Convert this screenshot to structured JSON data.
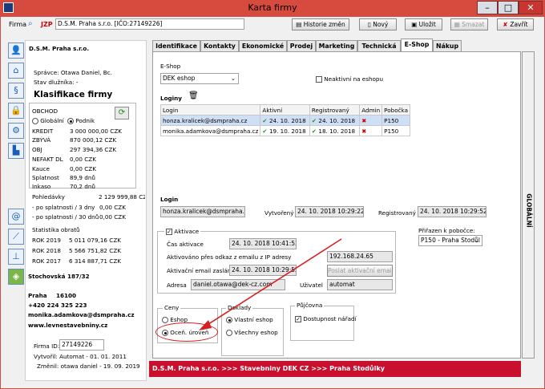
{
  "window": {
    "title": "Karta firmy",
    "minimize": "–",
    "maximize": "□",
    "close": "✕"
  },
  "toolbar": {
    "firma_label": "Firma",
    "jzp_label": "JZP",
    "firma_value": "D.S.M. Praha s.r.o.  [IČO:27149226]",
    "historie_label": "Historie změn",
    "novy_label": "Nový",
    "ulozit_label": "Uložit",
    "smazat_label": "Smazat",
    "zavrit_label": "Zavřít"
  },
  "left": {
    "company": "D.S.M. Praha s.r.o.",
    "spravce": "Správce:  Otawa Daniel, Bc.",
    "stav": "Stav dlužníka:  -",
    "klasifikace": "Klasifikace firmy",
    "obchod": "OBCHOD",
    "globalni": "Globální",
    "podnik": "Podnik",
    "rows": [
      {
        "k": "KREDIT",
        "v": "3 000 000,00 CZK"
      },
      {
        "k": "ZBÝVÁ",
        "v": "870 000,12 CZK"
      },
      {
        "k": "OBJ",
        "v": "297 394,36 CZK"
      },
      {
        "k": "NEFAKT DL",
        "v": "0,00 CZK"
      },
      {
        "k": "Kauce",
        "v": "0,00 CZK"
      },
      {
        "k": "Splatnost",
        "v": "89,9 dnů"
      },
      {
        "k": "Inkaso",
        "v": "70,2 dnů"
      }
    ],
    "pohledavky": "Pohledávky",
    "pohledavky_v": "2 129 999,88 CZ",
    "po1": "- po splatnosti / 3 dny",
    "po1_v": "0,00 CZK",
    "po2": "- po splatnosti / 30 dnů",
    "po2_v": "0,00 CZK",
    "statistika": "Statistika obratů",
    "roky": [
      {
        "k": "ROK 2019",
        "v": "5 011 079,16 CZK"
      },
      {
        "k": "ROK 2018",
        "v": "5 566 751,82 CZK"
      },
      {
        "k": "ROK 2017",
        "v": "6 314 887,71 CZK"
      }
    ],
    "address": "Stochovská 187/32",
    "city": "Praha",
    "zip": "16100",
    "phone": "+420 224 325 223",
    "email": "monika.adamkova@dsmpraha.cz",
    "web": "www.levnestavebniny.cz",
    "firma_id_label": "Firma ID:",
    "firma_id": "27149226",
    "vytvoril": "Vytvořil:  Automat - 01. 01. 2011",
    "zmenil": "Změnil:  otawa daniel - 19. 09. 2019"
  },
  "tabs": [
    "Identifikace",
    "Kontakty",
    "Ekonomické",
    "Prodej",
    "Marketing",
    "Technická",
    "E-Shop",
    "Nákup"
  ],
  "eshop": {
    "label": "E-Shop",
    "select": "DEK eshop",
    "neaktivni": "Neaktivní na eshopu",
    "loginy": "Loginy",
    "headers": [
      "Login",
      "Aktivní",
      "Registrovaný",
      "Admin",
      "Pobočka"
    ],
    "logins": [
      {
        "login": "honza.kralicek@dsmpraha.cz",
        "aktivni": "24. 10. 2018",
        "reg": "24. 10. 2018",
        "pobocka": "P150"
      },
      {
        "login": "monika.adamkova@dsmpraha.cz",
        "aktivni": "19. 10. 2018",
        "reg": "18. 10. 2018",
        "pobocka": "P150"
      }
    ],
    "login_label": "Login",
    "login_value": "honza.kralicek@dsmpraha.cz",
    "vytvoreny_label": "Vytvořený",
    "vytvoreny": "24. 10. 2018 10:29:22",
    "registrovany_label": "Registrovaný",
    "registrovany": "24. 10. 2018 10:29:52",
    "aktivace": "Aktivace",
    "cas_label": "Čas aktivace",
    "cas": "24. 10. 2018 10:41:53",
    "aktivovano_label": "Aktivováno přes odkaz z emailu z IP adresy",
    "ip": "192.168.24.65",
    "email_zaslan_label": "Aktivační email zaslán",
    "email_zaslan": "24. 10. 2018 10:29:52",
    "poslat_btn": "Poslat aktivační email",
    "adresa_label": "Adresa",
    "adresa": "daniel.otawa@dek-cz.com",
    "uzivatel_label": "Uživatel",
    "uzivatel": "automat",
    "prirazen_label": "Přiřazen k pobočce:",
    "prirazen": "P150 - Praha Stodůl",
    "ceny": "Ceny",
    "ceny_eshop": "Eshop",
    "ceny_ocen": "Oceň. úroveň",
    "doklady": "Doklady",
    "vlastni": "Vlastní eshop",
    "vsechny": "Všechny eshop",
    "pujcovna": "Půjčovna",
    "dostupnost": "Dostupnost nářadí",
    "globalni_vert": "GLOBÁLNÍ"
  },
  "footer": "D.S.M. Praha s.r.o. >>> Stavebniny DEK CZ >>> Praha Stodůlky"
}
